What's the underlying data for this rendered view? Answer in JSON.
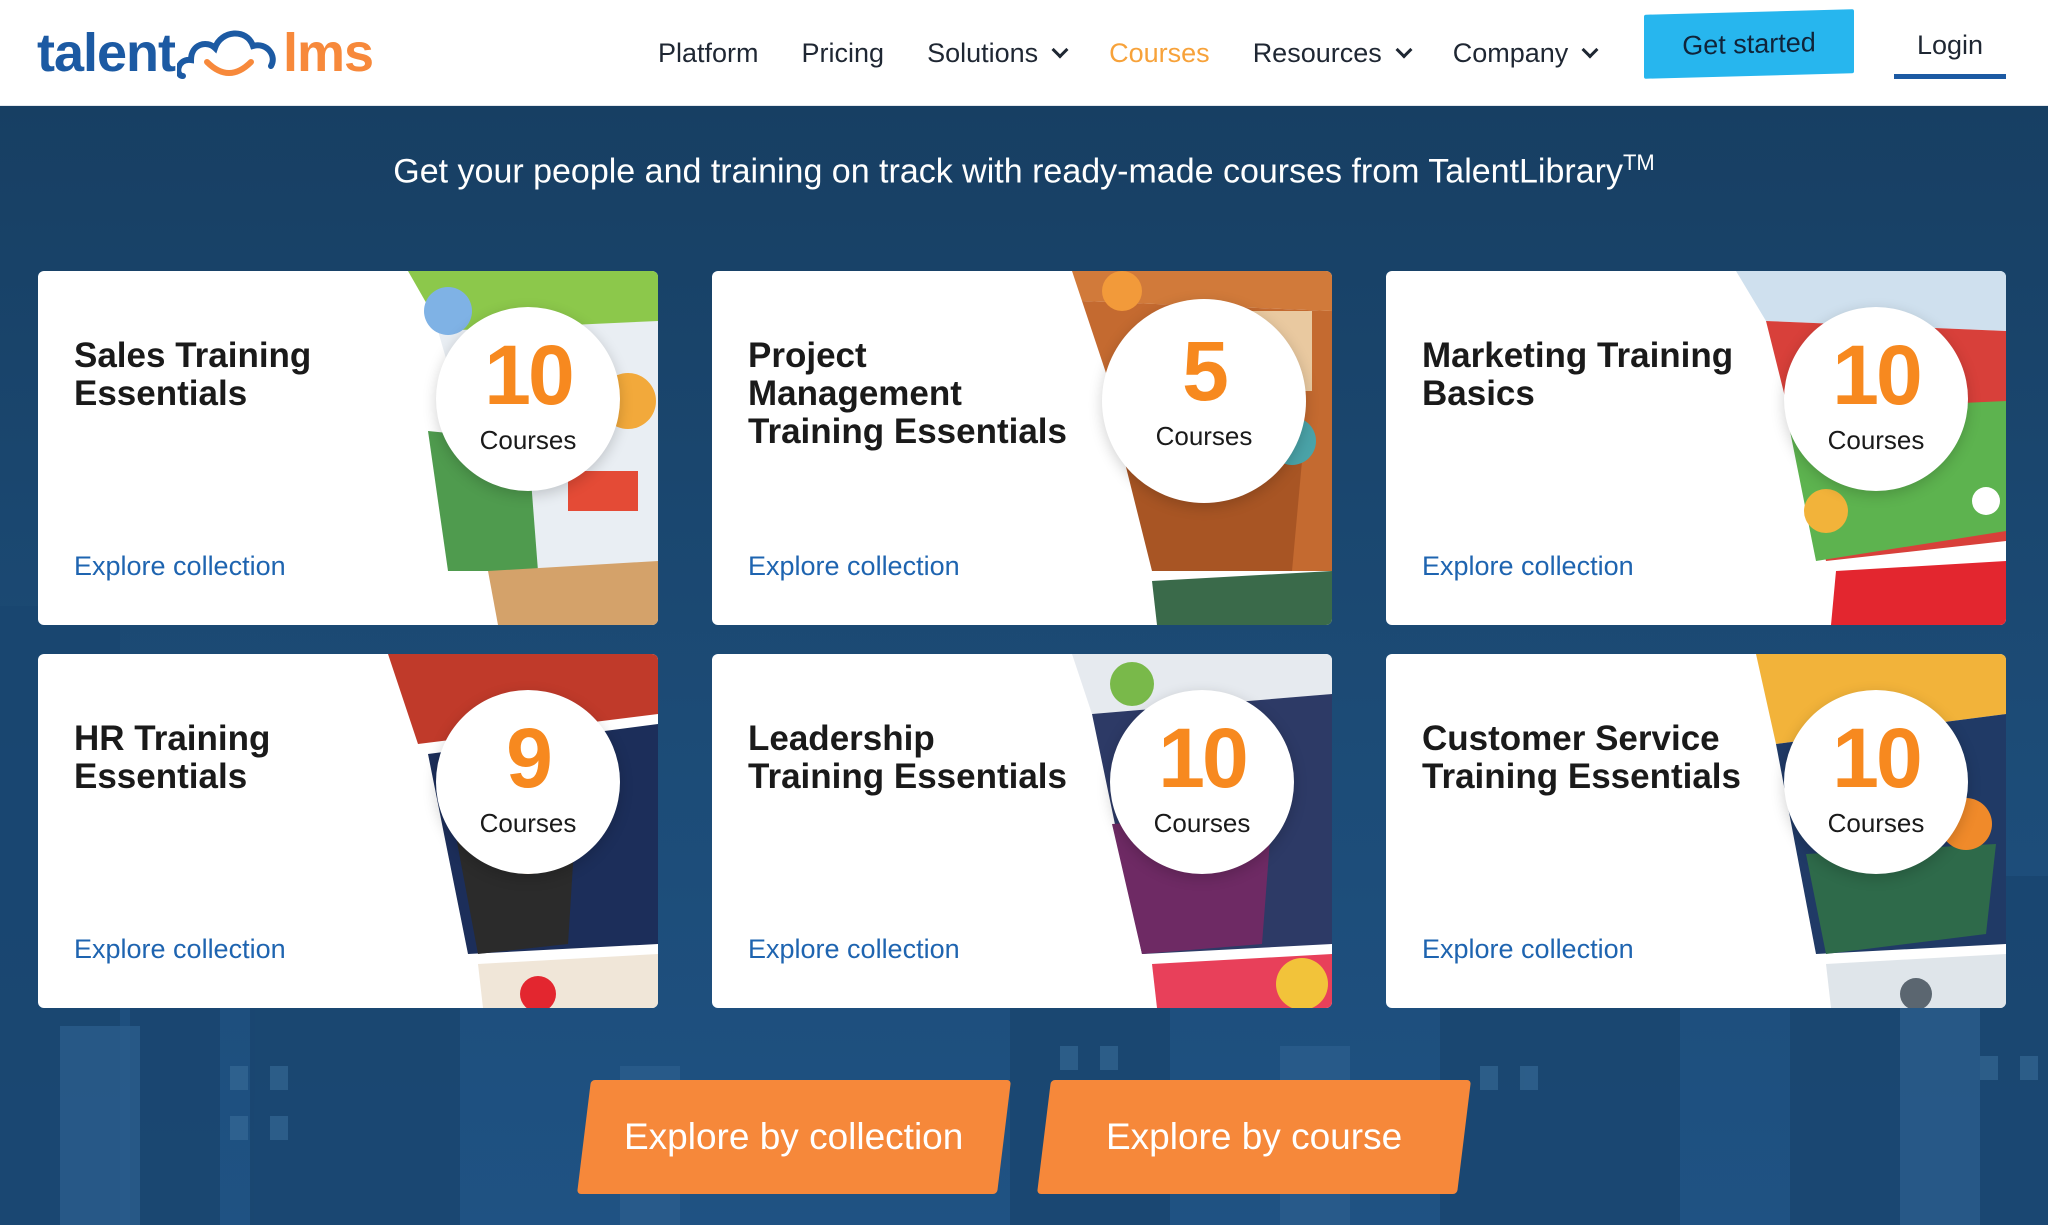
{
  "header": {
    "logo": {
      "part1": "talent",
      "part2": "lms"
    },
    "nav": [
      {
        "label": "Platform",
        "dropdown": false,
        "active": false
      },
      {
        "label": "Pricing",
        "dropdown": false,
        "active": false
      },
      {
        "label": "Solutions",
        "dropdown": true,
        "active": false
      },
      {
        "label": "Courses",
        "dropdown": false,
        "active": true
      },
      {
        "label": "Resources",
        "dropdown": true,
        "active": false
      },
      {
        "label": "Company",
        "dropdown": true,
        "active": false
      }
    ],
    "get_started": "Get started",
    "login": "Login"
  },
  "hero": {
    "tagline": "Get your people and training on track with ready-made courses from TalentLibrary",
    "tagline_sup": "TM"
  },
  "cards": [
    {
      "title": "Sales Training Essentials",
      "count": "10",
      "count_label": "Courses",
      "link": "Explore collection"
    },
    {
      "title": "Project Management Training Essentials",
      "count": "5",
      "count_label": "Courses",
      "link": "Explore collection"
    },
    {
      "title": "Marketing Training Basics",
      "count": "10",
      "count_label": "Courses",
      "link": "Explore collection"
    },
    {
      "title": "HR Training Essentials",
      "count": "9",
      "count_label": "Courses",
      "link": "Explore collection"
    },
    {
      "title": "Leadership Training Essentials",
      "count": "10",
      "count_label": "Courses",
      "link": "Explore collection"
    },
    {
      "title": "Customer Service Training Essentials",
      "count": "10",
      "count_label": "Courses",
      "link": "Explore collection"
    }
  ],
  "cta": {
    "by_collection": "Explore by collection",
    "by_course": "Explore by course"
  },
  "colors": {
    "brand_blue": "#1c5aa3",
    "brand_orange": "#f7893b",
    "accent_cyan": "#27b6ee",
    "hero_bg": "#1b4a72",
    "link_blue": "#1e64b0"
  }
}
